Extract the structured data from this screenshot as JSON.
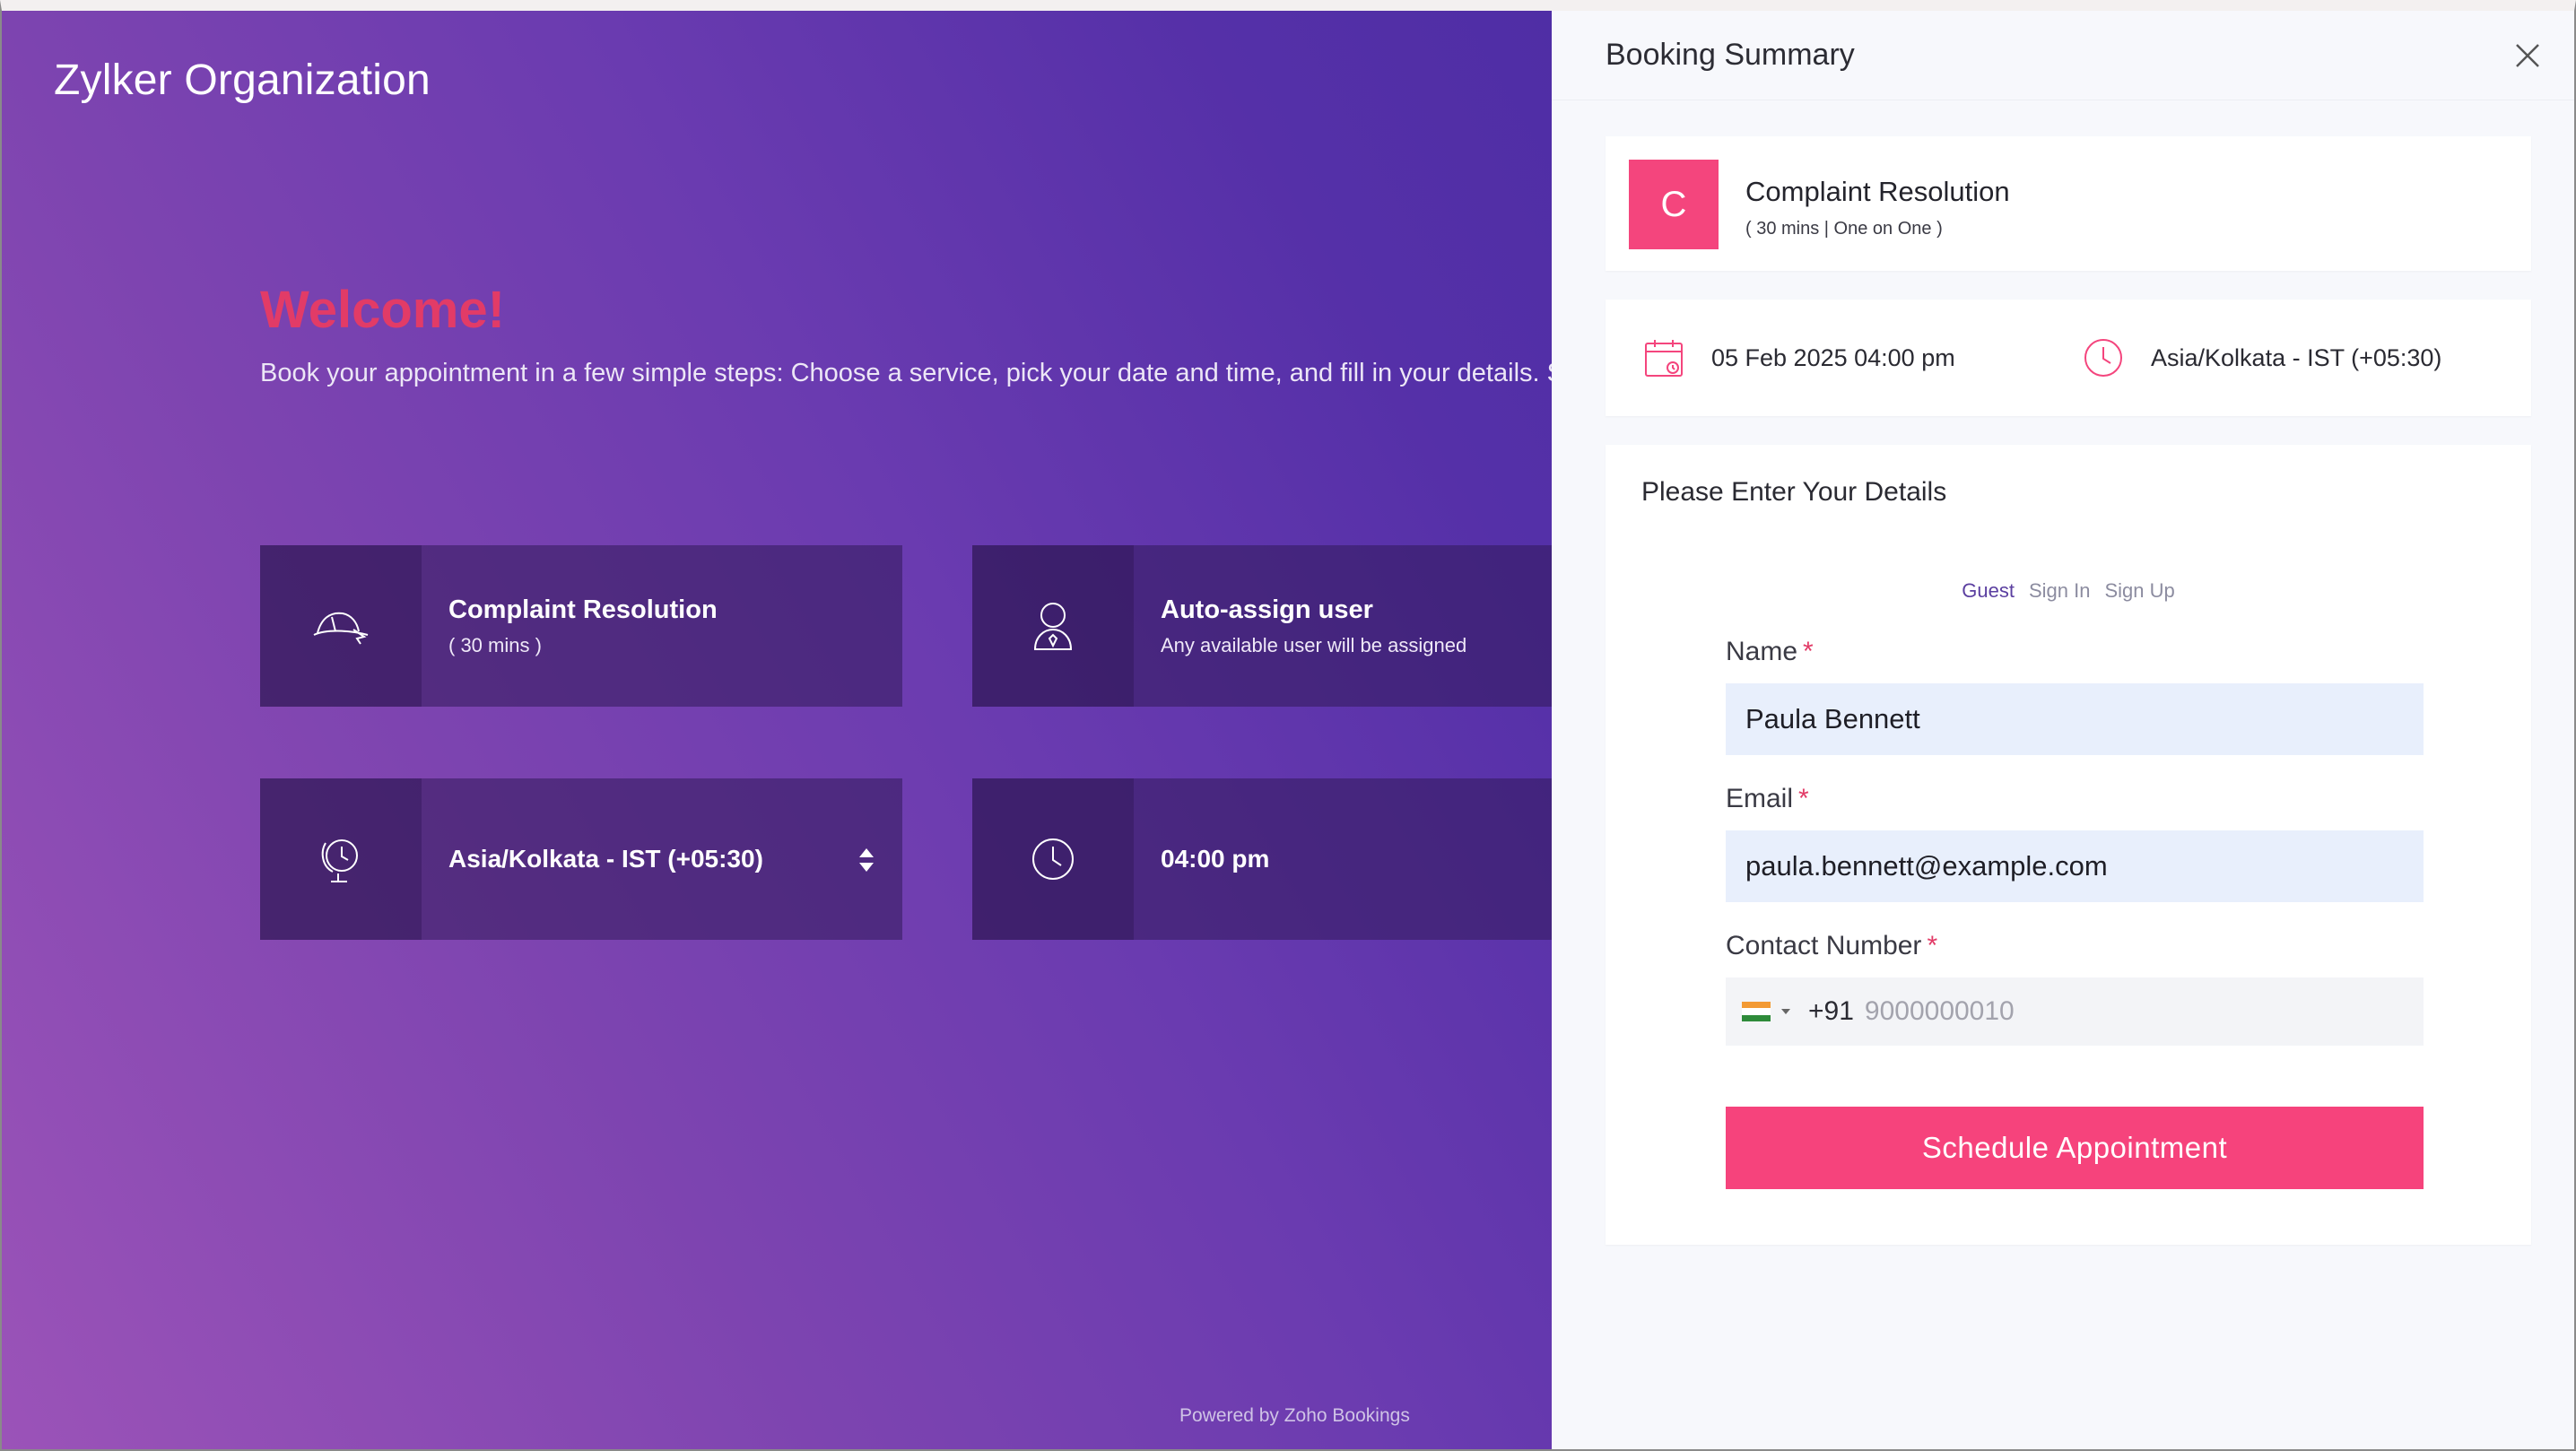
{
  "org": {
    "name": "Zylker Organization"
  },
  "welcome": {
    "heading": "Welcome!",
    "text": "Book your appointment in a few simple steps: Choose a service, pick your date and time, and fill in your details. S"
  },
  "cards": {
    "service": {
      "title": "Complaint Resolution",
      "sub": "( 30 mins )",
      "icon": "hat-icon"
    },
    "staff": {
      "title": "Auto-assign user",
      "sub": "Any available user will be assigned",
      "icon": "user-icon"
    },
    "timezone": {
      "value": "Asia/Kolkata - IST (+05:30)",
      "icon": "globe-clock-icon"
    },
    "time": {
      "value": "04:00 pm",
      "icon": "clock-icon"
    }
  },
  "footer": {
    "powered": "Powered by Zoho Bookings"
  },
  "summary": {
    "title": "Booking Summary",
    "service": {
      "initial": "C",
      "name": "Complaint Resolution",
      "sub": "( 30 mins | One on One )"
    },
    "datetime": "05 Feb 2025 04:00 pm",
    "timezone": "Asia/Kolkata - IST (+05:30)",
    "details_title": "Please Enter Your Details",
    "tabs": [
      "Guest",
      "Sign In",
      "Sign Up"
    ],
    "active_tab": "Guest",
    "form": {
      "name_label": "Name",
      "name_value": "Paula Bennett",
      "email_label": "Email",
      "email_value": "paula.bennett@example.com",
      "phone_label": "Contact Number",
      "dial_code": "+91",
      "phone_placeholder": "9000000010",
      "required_mark": "*"
    },
    "submit_label": "Schedule Appointment"
  },
  "colors": {
    "accent_pink": "#f6437c",
    "welcome_pink": "#e23b67",
    "tab_active": "#5b3fa0"
  }
}
